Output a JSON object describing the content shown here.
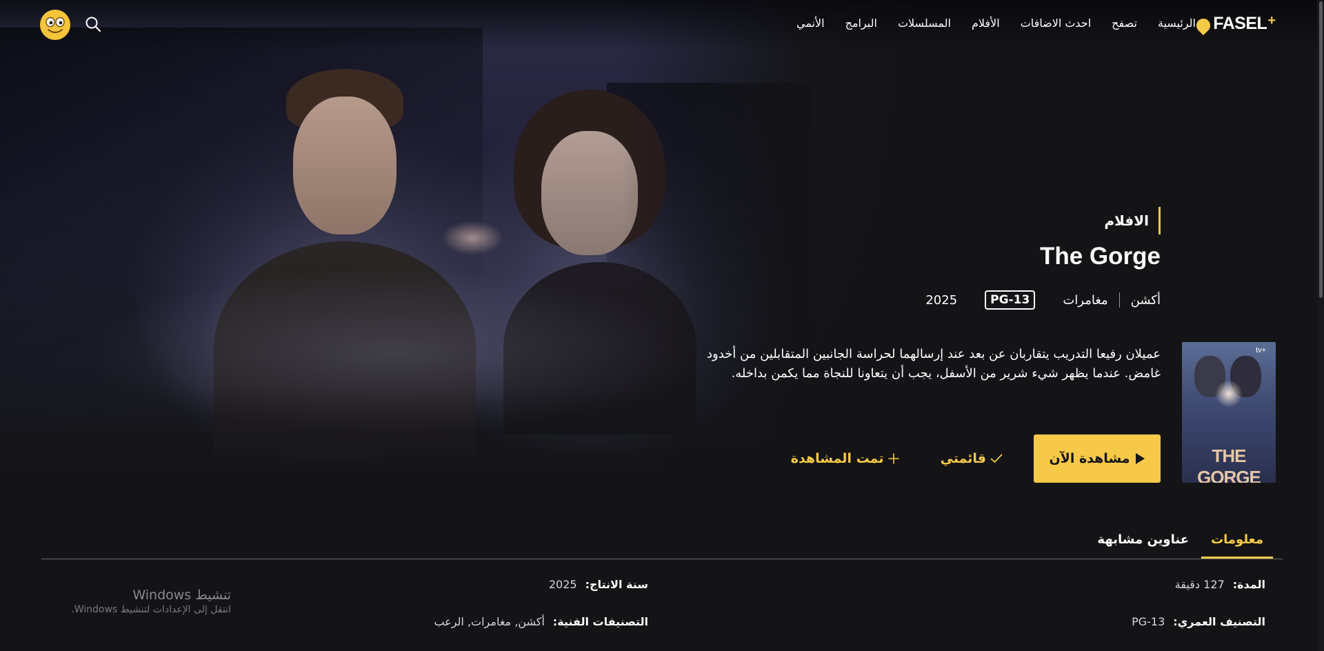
{
  "nav": {
    "logo_text": "FASEL",
    "logo_plus": "+",
    "items": [
      "الرئيسية",
      "تصفح",
      "احدث الاضافات",
      "الأفلام",
      "المسلسلات",
      "البرامج",
      "الأنمي"
    ]
  },
  "movie": {
    "category": "الافلام",
    "title": "The Gorge",
    "genres": [
      "أكشن",
      "مغامرات"
    ],
    "rating": "PG-13",
    "year": "2025",
    "description": "عميلان رفيعا التدريب يتقاربان عن بعد عند إرسالهما لحراسة الجانبين المتقابلين من أخدود غامض. عندما يظهر شيء شرير من الأسفل، يجب أن يتعاونا للنجاة مما يكمن بداخله.",
    "poster": {
      "brand": "tv+",
      "title": "THE GORGE"
    }
  },
  "actions": {
    "watch_now": "مشاهدة الآن",
    "my_list": "قائمتي",
    "watched": "تمت المشاهدة"
  },
  "tabs": {
    "info": "معلومات",
    "similar": "عناوين مشابهة"
  },
  "details": {
    "duration_label": "المدة:",
    "duration_value": "127 دقيقة",
    "year_label": "سنة الانتاج:",
    "year_value": "2025",
    "rating_label": "التصنيف العمري:",
    "rating_value": "PG-13",
    "genres_label": "التصنيفات الفنية:",
    "genres_value": "أكشن, مغامرات, الرعب"
  },
  "watermark": {
    "title": "تنشيط Windows",
    "subtitle": "انتقل إلى الإعدادات لتنشيط Windows."
  },
  "colors": {
    "accent": "#f7c948",
    "background": "#141416"
  }
}
